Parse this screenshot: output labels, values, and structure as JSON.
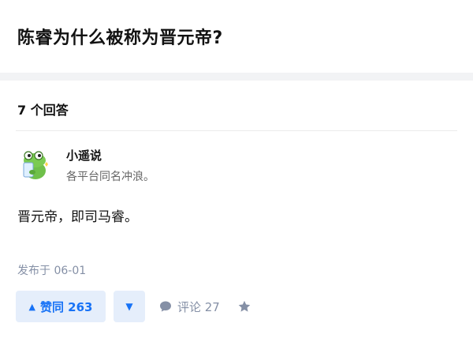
{
  "question": {
    "title": "陈睿为什么被称为晋元帝?"
  },
  "answers": {
    "count_label": "7 个回答",
    "items": [
      {
        "author": {
          "name": "小遥说",
          "bio": "各平台同名冲浪。",
          "avatar_icon": "green-frog-holding-phone-avatar"
        },
        "content": "晋元帝，即司马睿。",
        "publish_time": "发布于 06-01",
        "actions": {
          "vote_up_label": "赞同 263",
          "vote_down_icon": "triangle-down-icon",
          "comment_label": "评论 27",
          "comment_icon": "speech-bubble-icon",
          "favorite_icon": "star-icon"
        }
      }
    ]
  },
  "colors": {
    "accent_blue": "#1772f6",
    "accent_bg": "#e5eefb",
    "meta_gray": "#8590a6"
  }
}
